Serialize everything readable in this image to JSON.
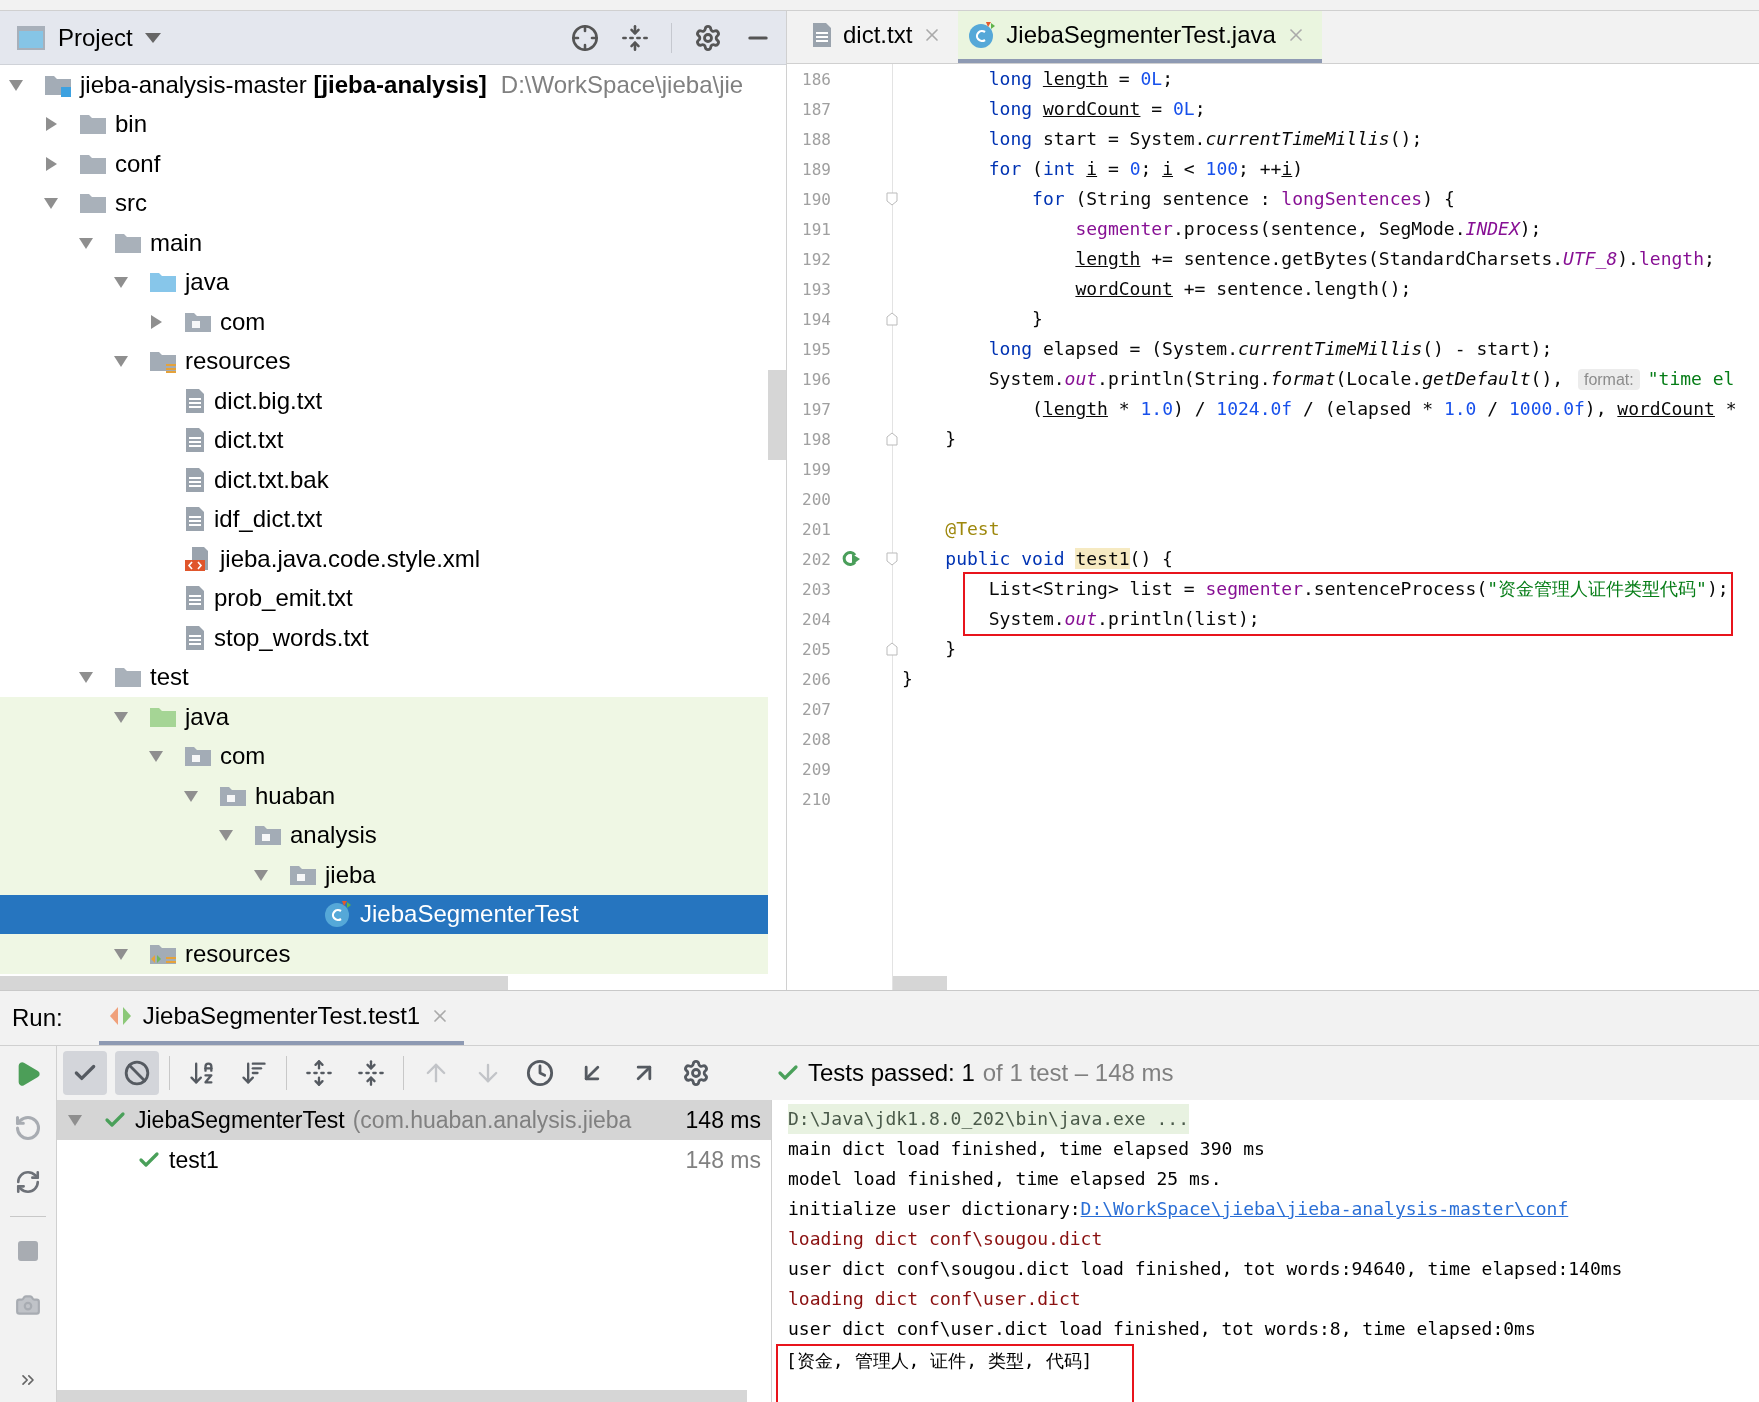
{
  "project_panel": {
    "title": "Project",
    "tree": [
      {
        "label": "jieba-analysis-master **[jieba-analysis]**",
        "path": "D:\\WorkSpace\\jieba\\jie",
        "kind": "module",
        "expanded": true,
        "selected": false,
        "tinted": false,
        "children": [
          {
            "label": "bin",
            "kind": "folder",
            "expanded": false,
            "selected": false,
            "tinted": false
          },
          {
            "label": "conf",
            "kind": "folder",
            "expanded": false,
            "selected": false,
            "tinted": false
          },
          {
            "label": "src",
            "kind": "folder",
            "expanded": true,
            "selected": false,
            "tinted": false,
            "children": [
              {
                "label": "main",
                "kind": "folder",
                "expanded": true,
                "selected": false,
                "tinted": false,
                "children": [
                  {
                    "label": "java",
                    "kind": "source",
                    "expanded": true,
                    "selected": false,
                    "tinted": false,
                    "children": [
                      {
                        "label": "com",
                        "kind": "package",
                        "expanded": false,
                        "selected": false,
                        "tinted": false
                      }
                    ]
                  },
                  {
                    "label": "resources",
                    "kind": "resources",
                    "expanded": true,
                    "selected": false,
                    "tinted": false,
                    "children": [
                      {
                        "label": "dict.big.txt",
                        "kind": "text",
                        "selected": false,
                        "tinted": false
                      },
                      {
                        "label": "dict.txt",
                        "kind": "text",
                        "selected": false,
                        "tinted": false
                      },
                      {
                        "label": "dict.txt.bak",
                        "kind": "text",
                        "selected": false,
                        "tinted": false
                      },
                      {
                        "label": "idf_dict.txt",
                        "kind": "text",
                        "selected": false,
                        "tinted": false
                      },
                      {
                        "label": "jieba.java.code.style.xml",
                        "kind": "xml",
                        "selected": false,
                        "tinted": false
                      },
                      {
                        "label": "prob_emit.txt",
                        "kind": "text",
                        "selected": false,
                        "tinted": false
                      },
                      {
                        "label": "stop_words.txt",
                        "kind": "text",
                        "selected": false,
                        "tinted": false
                      }
                    ]
                  }
                ]
              },
              {
                "label": "test",
                "kind": "folder",
                "expanded": true,
                "selected": false,
                "tinted": false,
                "children": [
                  {
                    "label": "java",
                    "kind": "test-source",
                    "expanded": true,
                    "selected": false,
                    "tinted": true,
                    "children": [
                      {
                        "label": "com",
                        "kind": "package",
                        "expanded": true,
                        "selected": false,
                        "tinted": true,
                        "children": [
                          {
                            "label": "huaban",
                            "kind": "package",
                            "expanded": true,
                            "selected": false,
                            "tinted": true,
                            "children": [
                              {
                                "label": "analysis",
                                "kind": "package",
                                "expanded": true,
                                "selected": false,
                                "tinted": true,
                                "children": [
                                  {
                                    "label": "jieba",
                                    "kind": "package",
                                    "expanded": true,
                                    "selected": false,
                                    "tinted": true,
                                    "children": [
                                      {
                                        "label": "JiebaSegmenterTest",
                                        "kind": "class",
                                        "selected": true
                                      }
                                    ]
                                  }
                                ]
                              }
                            ]
                          }
                        ]
                      }
                    ]
                  },
                  {
                    "label": "resources",
                    "kind": "test-resources",
                    "expanded": true,
                    "selected": false,
                    "tinted": true
                  }
                ]
              }
            ]
          }
        ]
      }
    ]
  },
  "editor": {
    "tabs": [
      {
        "label": "dict.txt",
        "kind": "text",
        "selected": false
      },
      {
        "label": "JiebaSegmenterTest.java",
        "kind": "class",
        "selected": true
      }
    ],
    "lines": [
      {
        "number": "186",
        "segments": [
          {
            "text": "        long ",
            "kind": "kw"
          },
          {
            "text": "length",
            "kind": "var"
          },
          {
            "text": " = ",
            "kind": "plain"
          },
          {
            "text": "0L",
            "kind": "num"
          },
          {
            "text": ";",
            "kind": "plain"
          }
        ]
      },
      {
        "number": "187",
        "segments": [
          {
            "text": "        long ",
            "kind": "kw"
          },
          {
            "text": "wordCount",
            "kind": "var"
          },
          {
            "text": " = ",
            "kind": "plain"
          },
          {
            "text": "0L",
            "kind": "num"
          },
          {
            "text": ";",
            "kind": "plain"
          }
        ]
      },
      {
        "number": "188",
        "segments": [
          {
            "text": "        long",
            "kind": "kw"
          },
          {
            "text": " start = System.",
            "kind": "plain"
          },
          {
            "text": "currentTimeMillis",
            "kind": "italic"
          },
          {
            "text": "();",
            "kind": "plain"
          }
        ]
      },
      {
        "number": "189",
        "segments": [
          {
            "text": "        for",
            "kind": "kw"
          },
          {
            "text": " (",
            "kind": "plain"
          },
          {
            "text": "int ",
            "kind": "kw"
          },
          {
            "text": "i",
            "kind": "var"
          },
          {
            "text": " = ",
            "kind": "plain"
          },
          {
            "text": "0",
            "kind": "num"
          },
          {
            "text": "; ",
            "kind": "plain"
          },
          {
            "text": "i",
            "kind": "var"
          },
          {
            "text": " < ",
            "kind": "plain"
          },
          {
            "text": "100",
            "kind": "num"
          },
          {
            "text": "; ++",
            "kind": "plain"
          },
          {
            "text": "i",
            "kind": "var"
          },
          {
            "text": ")",
            "kind": "plain"
          }
        ]
      },
      {
        "number": "190",
        "fold": {
          "kind": "open"
        },
        "segments": [
          {
            "text": "            for",
            "kind": "kw"
          },
          {
            "text": " (String sentence : ",
            "kind": "plain"
          },
          {
            "text": "longSentences",
            "kind": "field"
          },
          {
            "text": ") {",
            "kind": "plain"
          }
        ]
      },
      {
        "number": "191",
        "segments": [
          {
            "text": "                segmenter",
            "kind": "field"
          },
          {
            "text": ".process(sentence, SegMode.",
            "kind": "plain"
          },
          {
            "text": "INDEX",
            "kind": "static"
          },
          {
            "text": ");",
            "kind": "plain"
          }
        ]
      },
      {
        "number": "192",
        "segments": [
          {
            "text": "                length",
            "kind": "var"
          },
          {
            "text": " += sentence.getBytes(StandardCharsets.",
            "kind": "plain"
          },
          {
            "text": "UTF_8",
            "kind": "static"
          },
          {
            "text": ").",
            "kind": "plain"
          },
          {
            "text": "length",
            "kind": "field"
          },
          {
            "text": ";",
            "kind": "plain"
          }
        ]
      },
      {
        "number": "193",
        "segments": [
          {
            "text": "                wordCount",
            "kind": "var"
          },
          {
            "text": " += sentence.length();",
            "kind": "plain"
          }
        ]
      },
      {
        "number": "194",
        "fold": {
          "kind": "close"
        },
        "segments": [
          {
            "text": "            }",
            "kind": "plain"
          }
        ]
      },
      {
        "number": "195",
        "segments": [
          {
            "text": "        long",
            "kind": "kw"
          },
          {
            "text": " elapsed = (System.",
            "kind": "plain"
          },
          {
            "text": "currentTimeMillis",
            "kind": "italic"
          },
          {
            "text": "() - start);",
            "kind": "plain"
          }
        ]
      },
      {
        "number": "196",
        "segments": [
          {
            "text": "        System.",
            "kind": "plain"
          },
          {
            "text": "out",
            "kind": "static"
          },
          {
            "text": ".println(String.",
            "kind": "plain"
          },
          {
            "text": "format",
            "kind": "italic"
          },
          {
            "text": "(Locale.",
            "kind": "plain"
          },
          {
            "text": "getDefault",
            "kind": "italic"
          },
          {
            "text": "(), ",
            "kind": "plain"
          },
          {
            "text": "format:",
            "kind": "hint"
          },
          {
            "text": "\"time el",
            "kind": "str"
          }
        ]
      },
      {
        "number": "197",
        "segments": [
          {
            "text": "            (",
            "kind": "plain"
          },
          {
            "text": "length",
            "kind": "var"
          },
          {
            "text": " * ",
            "kind": "plain"
          },
          {
            "text": "1.0",
            "kind": "num"
          },
          {
            "text": ") / ",
            "kind": "plain"
          },
          {
            "text": "1024.0f",
            "kind": "num"
          },
          {
            "text": " / (elapsed * ",
            "kind": "plain"
          },
          {
            "text": "1.0",
            "kind": "num"
          },
          {
            "text": " / ",
            "kind": "plain"
          },
          {
            "text": "1000.0f",
            "kind": "num"
          },
          {
            "text": "), ",
            "kind": "plain"
          },
          {
            "text": "wordCount",
            "kind": "var"
          },
          {
            "text": " *",
            "kind": "plain"
          }
        ]
      },
      {
        "number": "198",
        "fold": {
          "kind": "close"
        },
        "segments": [
          {
            "text": "    }",
            "kind": "plain"
          }
        ]
      },
      {
        "number": "199"
      },
      {
        "number": "200"
      },
      {
        "number": "201",
        "segments": [
          {
            "text": "    @Test",
            "kind": "annot"
          }
        ]
      },
      {
        "number": "202",
        "fold": {
          "kind": "open"
        },
        "run_marker": true,
        "segments": [
          {
            "text": "    public void ",
            "kind": "kw"
          },
          {
            "text": "test1",
            "kind": "ident"
          },
          {
            "text": "() {",
            "kind": "plain"
          }
        ]
      },
      {
        "number": "203",
        "boxed": true,
        "segments": [
          {
            "text": "        List<String> list = ",
            "kind": "plain"
          },
          {
            "text": "segmenter",
            "kind": "field"
          },
          {
            "text": ".sentenceProcess(",
            "kind": "plain"
          },
          {
            "text": "\"资金管理人证件类型代码\"",
            "kind": "str"
          },
          {
            "text": ");",
            "kind": "plain"
          }
        ]
      },
      {
        "number": "204",
        "boxed": true,
        "segments": [
          {
            "text": "        System.",
            "kind": "plain"
          },
          {
            "text": "out",
            "kind": "static"
          },
          {
            "text": ".println(list);",
            "kind": "plain"
          }
        ]
      },
      {
        "number": "205",
        "fold": {
          "kind": "close"
        },
        "segments": [
          {
            "text": "    }",
            "kind": "plain"
          }
        ]
      },
      {
        "number": "206",
        "segments": [
          {
            "text": "}",
            "kind": "plain"
          }
        ]
      },
      {
        "number": "207"
      },
      {
        "number": "208"
      },
      {
        "number": "209"
      },
      {
        "number": "210"
      }
    ]
  },
  "run_panel": {
    "label": "Run:",
    "tabs": [
      {
        "label": "JiebaSegmenterTest.test1",
        "selected": true
      }
    ],
    "toolbar": [
      {
        "kind": "show-passed",
        "on": true,
        "disabled": false
      },
      {
        "kind": "show-ignored",
        "on": true,
        "disabled": false
      },
      {
        "kind": "sort-alpha",
        "on": false,
        "disabled": false
      },
      {
        "kind": "sort-duration",
        "on": false,
        "disabled": false
      },
      {
        "kind": "expand-all",
        "on": false,
        "disabled": false
      },
      {
        "kind": "collapse-all",
        "on": false,
        "disabled": false
      },
      {
        "kind": "previous",
        "on": false,
        "disabled": true
      },
      {
        "kind": "next",
        "on": false,
        "disabled": true
      },
      {
        "kind": "history",
        "on": false,
        "disabled": false
      },
      {
        "kind": "import",
        "on": false,
        "disabled": false
      },
      {
        "kind": "export",
        "on": false,
        "disabled": false
      },
      {
        "kind": "settings",
        "on": false,
        "disabled": false
      }
    ],
    "status": {
      "summary": "Tests passed: 1",
      "detail": "of 1 test – 148 ms",
      "passed": true
    },
    "tests": [
      {
        "name": "JiebaSegmenterTest",
        "detail": "(com.huaban.analysis.jieba",
        "time": "148 ms",
        "passed": true,
        "expanded": true,
        "selected": true,
        "children": [
          {
            "name": "test1",
            "time": "148 ms",
            "passed": true,
            "selected": false
          }
        ]
      }
    ],
    "console": [
      {
        "text": "D:\\Java\\jdk1.8.0_202\\bin\\java.exe ...",
        "kind": "command"
      },
      {
        "text": "main dict load finished, time elapsed 390 ms",
        "kind": "info"
      },
      {
        "text": "model load finished, time elapsed 25 ms.",
        "kind": "info"
      },
      {
        "text": "initialize user dictionary:",
        "link": "D:\\WorkSpace\\jieba\\jieba-analysis-master\\conf",
        "kind": "info"
      },
      {
        "text": "loading dict conf\\sougou.dict",
        "kind": "error"
      },
      {
        "text": "user dict conf\\sougou.dict load finished, tot words:94640, time elapsed:140ms",
        "kind": "info"
      },
      {
        "text": "loading dict conf\\user.dict",
        "kind": "error"
      },
      {
        "text": "user dict conf\\user.dict load finished, tot words:8, time elapsed:0ms",
        "kind": "info"
      },
      {
        "text": "[资金, 管理人, 证件, 类型, 代码]",
        "kind": "info",
        "boxed": true
      }
    ]
  }
}
